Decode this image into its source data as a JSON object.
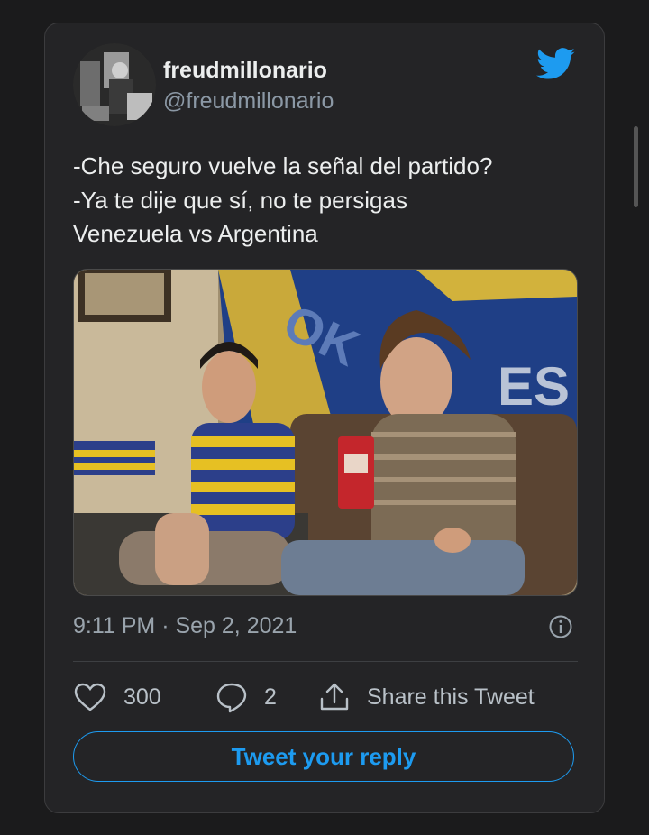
{
  "tweet": {
    "display_name": "freudmillonario",
    "handle": "@freudmillonario",
    "text_lines": [
      "-Che seguro vuelve la señal del partido?",
      "-Ya te dije que sí, no te persigas",
      "Venezuela vs Argentina"
    ],
    "timestamp": "9:11 PM · Sep 2, 2021"
  },
  "actions": {
    "likes": "300",
    "replies": "2",
    "share_label": "Share this Tweet"
  },
  "reply_button_label": "Tweet your reply",
  "media": {
    "flag_letters": [
      "OK",
      "ES"
    ]
  },
  "icons": {
    "brand": "twitter-bird-icon",
    "info": "info-icon",
    "like": "heart-icon",
    "reply": "speech-bubble-icon",
    "share": "share-upload-icon"
  },
  "colors": {
    "background": "#1b1b1c",
    "card": "#242426",
    "accent": "#1d9bf0",
    "muted_text": "#8b98a5"
  }
}
